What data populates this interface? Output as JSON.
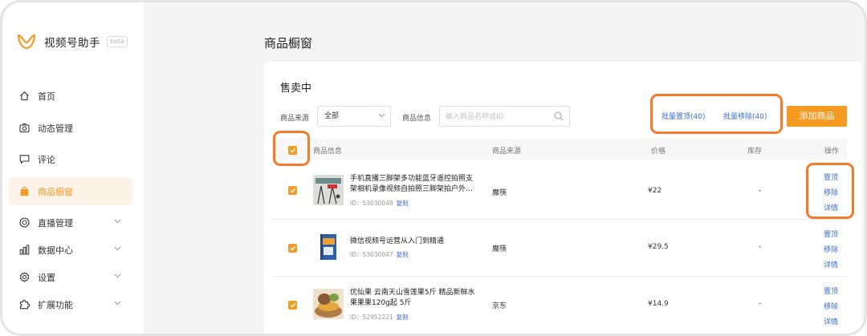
{
  "app": {
    "title": "视频号助手",
    "badge": "beta"
  },
  "sidebar": {
    "items": [
      {
        "label": "首页",
        "icon": "home-icon"
      },
      {
        "label": "动态管理",
        "icon": "camera-icon"
      },
      {
        "label": "评论",
        "icon": "comment-icon"
      },
      {
        "label": "商品橱窗",
        "icon": "shopping-bag-icon",
        "active": true
      },
      {
        "label": "直播管理",
        "icon": "live-icon",
        "expandable": true
      },
      {
        "label": "数据中心",
        "icon": "chart-icon",
        "expandable": true
      },
      {
        "label": "设置",
        "icon": "gear-icon",
        "expandable": true
      },
      {
        "label": "扩展功能",
        "icon": "puzzle-icon",
        "expandable": true
      }
    ]
  },
  "page": {
    "title": "商品橱窗"
  },
  "section": {
    "title": "售卖中"
  },
  "filters": {
    "source_label": "商品来源",
    "source_value": "全部",
    "info_label": "商品信息",
    "search_placeholder": "输入商品名称或ID"
  },
  "actions": {
    "batch_pin": "批量置顶(40)",
    "batch_remove": "批量移除(40)",
    "add_product": "添加商品"
  },
  "table": {
    "headers": {
      "info": "商品信息",
      "source": "商品来源",
      "price": "价格",
      "stock": "库存",
      "ops": "操作"
    },
    "rows": [
      {
        "name": "手机直播三脚架多功能蓝牙遥控拍照支架相机录像视频自拍照三脚架拍户外…",
        "id": "ID：53030048",
        "copy": "复制",
        "source": "魔筷",
        "price": "¥22",
        "stock": "-",
        "ops": [
          "置顶",
          "移除",
          "详情"
        ]
      },
      {
        "name": "微信视频号运营从入门到精通",
        "id": "ID：53030047",
        "copy": "复制",
        "source": "魔筷",
        "price": "¥29.5",
        "stock": "-",
        "ops": [
          "置顶",
          "移除",
          "详情"
        ]
      },
      {
        "name": "优仙果 云南天山雪莲果5斤 精品新鲜水果果果120g起 5斤",
        "id": "ID：52952221",
        "copy": "复制",
        "source": "京东",
        "price": "¥14.9",
        "stock": "-",
        "ops": [
          "置顶",
          "移除",
          "详情"
        ]
      }
    ]
  },
  "colors": {
    "accent": "#f59a23",
    "highlight": "#f57a2a",
    "link": "#3b6fd1"
  }
}
